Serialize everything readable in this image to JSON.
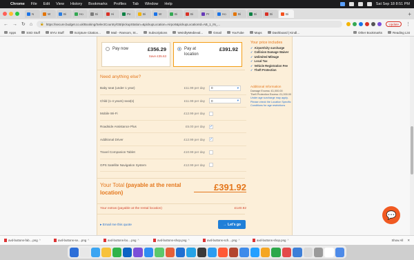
{
  "menubar": {
    "app_name": "Chrome",
    "menus": [
      "File",
      "Edit",
      "View",
      "History",
      "Bookmarks",
      "Profiles",
      "Tab",
      "Window",
      "Help"
    ],
    "clock": "Sat Sep 18 8:51 PM"
  },
  "tabs": [
    {
      "label": "N",
      "color": "#1a73e8"
    },
    {
      "label": "W",
      "color": "#e37400"
    },
    {
      "label": "Bi",
      "color": "#2a7de1"
    },
    {
      "label": "Ho",
      "color": "#34a853"
    },
    {
      "label": "Bi",
      "color": "#7b7b7b"
    },
    {
      "label": "Hi",
      "color": "#d93025"
    },
    {
      "label": "Pe",
      "color": "#0b8043"
    },
    {
      "label": "Bi",
      "color": "#f4b400"
    },
    {
      "label": "W",
      "color": "#1a73e8"
    },
    {
      "label": "Bi",
      "color": "#34a853"
    },
    {
      "label": "Bi",
      "color": "#d93025"
    },
    {
      "label": "Pr",
      "color": "#673ab7"
    },
    {
      "label": "Ho",
      "color": "#1a73e8"
    },
    {
      "label": "Bi",
      "color": "#e37400"
    },
    {
      "label": "Bi",
      "color": "#0b8043"
    },
    {
      "label": "Bi",
      "color": "#d93025"
    },
    {
      "label": "Bi",
      "color": "#f4511e",
      "active": true
    }
  ],
  "toolbar": {
    "url": "https://secure.budget.co.uk/Booking/SelectCountry/GB/pickupStation=&pickupLocation=Airport&pickupLocationId=AB_1_IN_...",
    "update_label": "Update"
  },
  "bookmarks": {
    "left": [
      "Apps",
      "SSD Stuff",
      "BYU Stuff",
      "Scripture Citation...",
      "Mail - Ransom, St...",
      "Subscriptions",
      "WeirdlyMedieval...",
      "Gmail",
      "YouTube",
      "Maps",
      "Dashboard | Kindl..."
    ],
    "right": [
      "Other Bookmarks",
      "Reading List"
    ]
  },
  "payment": {
    "now": {
      "label": "Pay now",
      "price": "£356.29",
      "save": "Save £35.63"
    },
    "later": {
      "label_line1": "Pay at",
      "label_line2": "location",
      "price": "£391.92"
    }
  },
  "includes": {
    "title": "Your price includes",
    "items": [
      "Airport/city surcharge",
      "Collision Damage Waiver",
      "Unlimited Mileage",
      "Local Tax",
      "Vehicle Registration Fee",
      "Theft Protection"
    ]
  },
  "extras_title": "Need anything else?",
  "extras": [
    {
      "name": "Baby seat (under 1 year)",
      "price": "£11.99 per day",
      "control": "select",
      "value": "0"
    },
    {
      "name": "Child (1-4 years) seat(s)",
      "price": "£11.99 per day",
      "control": "select",
      "value": "0"
    },
    {
      "name": "Mobile Wi-Fi",
      "price": "£12.99 per day",
      "control": "checkbox",
      "checked": false
    },
    {
      "name": "Roadside Assistance Plus",
      "price": "£5.00 per day",
      "control": "checkbox",
      "checked": true
    },
    {
      "name": "Additional Driver",
      "price": "£12.99 per day",
      "control": "checkbox",
      "checked": true
    },
    {
      "name": "Travel Companion Tablet",
      "price": "£10.99 per day",
      "control": "checkbox",
      "checked": false
    },
    {
      "name": "GPS Satellite Navigation System",
      "price": "£12.99 per day",
      "control": "checkbox",
      "checked": false
    }
  ],
  "additional_info": {
    "title": "Additional Information",
    "lines": [
      "Damage Excess: £1,000.00",
      "Theft Protection Excess: £1,000.00"
    ],
    "note": "Under age surcharge may apply. Please check the Location Specific Conditions for age restrictions"
  },
  "total": {
    "label": "Your Total",
    "label_bold": "(payable at the rental location)",
    "amount": "£391.92",
    "extras_label": "Your extras (payable at the rental location)",
    "extras_amount": "£140.92"
  },
  "actions": {
    "email": "Email me this quote",
    "go": "Let's go"
  },
  "downloads": {
    "items": [
      "avd-buttons-fab....png",
      "avd-buttons-se....png",
      "avd-buttons-bo....png",
      "avd-buttons-shop.png",
      "avd-buttons-sch....png",
      "avd-buttons-shop.png"
    ],
    "show_all": "Show All"
  },
  "dock_colors": [
    "#2c6ed8",
    "#e8e8e8",
    "#3ba5f2",
    "#f7c23a",
    "#30b34a",
    "#0d63c4",
    "#7b4fd8",
    "#2f8ef3",
    "#5bc86b",
    "#e45f39",
    "#1f6fd1",
    "#26a3e7",
    "#3a3a3a",
    "#2c9cf0",
    "#ff5a36",
    "#b3462f",
    "#3e8bea",
    "#24a0ff",
    "#f5a623",
    "#2ca84a",
    "#e34a4a",
    "#3d7fd8",
    "#d9d9d9",
    "#9a9a9a",
    "#ffffff",
    "#4d8ae8"
  ]
}
